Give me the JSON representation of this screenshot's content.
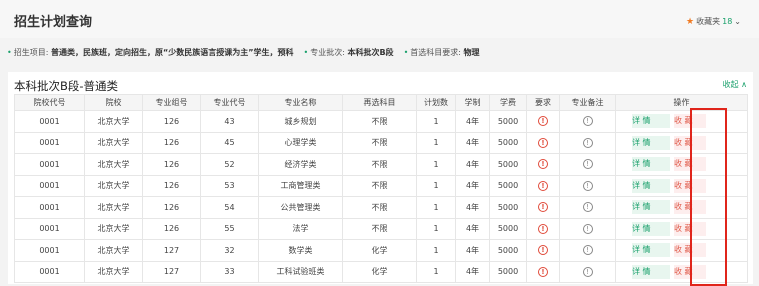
{
  "header": {
    "title": "招生计划查询",
    "favorites_label": "收藏夹",
    "favorites_count": "18",
    "colors": {
      "accent": "#19a06b",
      "highlight": "#e0251b"
    }
  },
  "filters": [
    {
      "label": "招生项目:",
      "value": "普通类，民族班，定向招生，原“少数民族语言授课为主”学生，预科"
    },
    {
      "label": "专业批次:",
      "value": "本科批次B段"
    },
    {
      "label": "首选科目要求:",
      "value": "物理"
    }
  ],
  "section": {
    "title": "本科批次B段-普通类",
    "collapse_label": "收起"
  },
  "table": {
    "columns": [
      "院校代号",
      "院校",
      "专业组号",
      "专业代号",
      "专业名称",
      "再选科目",
      "计划数",
      "学制",
      "学费",
      "要求",
      "专业备注",
      "操作"
    ],
    "detail_label": "详 情",
    "fav_label": "收 藏",
    "rows": [
      [
        "0001",
        "北京大学",
        "126",
        "43",
        "城乡规划",
        "不限",
        "1",
        "4年",
        "5000"
      ],
      [
        "0001",
        "北京大学",
        "126",
        "45",
        "心理学类",
        "不限",
        "1",
        "4年",
        "5000"
      ],
      [
        "0001",
        "北京大学",
        "126",
        "52",
        "经济学类",
        "不限",
        "1",
        "4年",
        "5000"
      ],
      [
        "0001",
        "北京大学",
        "126",
        "53",
        "工商管理类",
        "不限",
        "1",
        "4年",
        "5000"
      ],
      [
        "0001",
        "北京大学",
        "126",
        "54",
        "公共管理类",
        "不限",
        "1",
        "4年",
        "5000"
      ],
      [
        "0001",
        "北京大学",
        "126",
        "55",
        "法学",
        "不限",
        "1",
        "4年",
        "5000"
      ],
      [
        "0001",
        "北京大学",
        "127",
        "32",
        "数学类",
        "化学",
        "1",
        "4年",
        "5000"
      ],
      [
        "0001",
        "北京大学",
        "127",
        "33",
        "工科试验班类",
        "化学",
        "1",
        "4年",
        "5000"
      ]
    ]
  }
}
